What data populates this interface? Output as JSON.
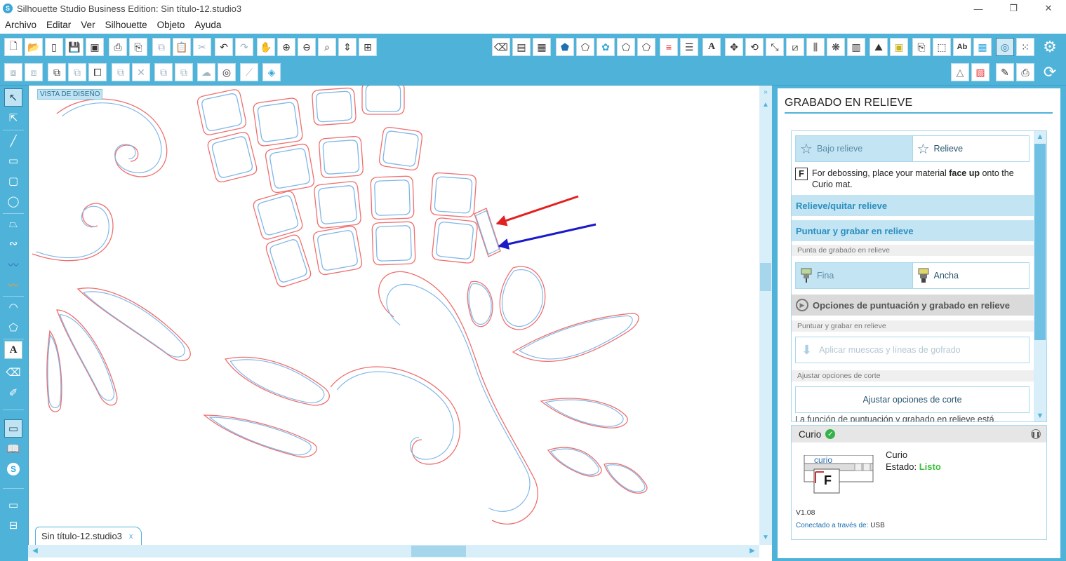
{
  "window": {
    "title": "Silhouette Studio Business Edition: Sin título-12.studio3",
    "controls": [
      "—",
      "❐",
      "✕"
    ]
  },
  "menu": [
    "Archivo",
    "Editar",
    "Ver",
    "Silhouette",
    "Objeto",
    "Ayuda"
  ],
  "canvas": {
    "view_label": "VISTA DE DISEÑO",
    "doc_tab": "Sin título-12.studio3",
    "doc_tab_close": "x",
    "cut_line_color": "#ef6f6f",
    "emboss_line_color": "#7fb7e8",
    "arrow_colors": [
      "#e32020",
      "#1a1acb"
    ]
  },
  "panel": {
    "title": "GRABADO EN RELIEVE",
    "mode_buttons": [
      {
        "label": "Bajo relieve",
        "icon": "deboss-star-icon",
        "selected": true
      },
      {
        "label": "Relieve",
        "icon": "emboss-star-icon",
        "selected": false
      }
    ],
    "hint_icon": "F",
    "hint_prefix": "For debossing, place your material ",
    "hint_bold": "face up",
    "hint_suffix": " onto the Curio mat.",
    "section_toggle": "Relieve/quitar relieve",
    "section_dot": "Puntuar y grabar en relieve",
    "tip_header": "Punta de grabado en relieve",
    "tip_buttons": [
      {
        "label": "Fina",
        "icon": "fine-tip-icon",
        "selected": true
      },
      {
        "label": "Ancha",
        "icon": "broad-tip-icon",
        "selected": false
      }
    ],
    "options_band": "Opciones de puntuación y grabado en relieve",
    "dot_header": "Puntuar y grabar en relieve",
    "apply_button": "Aplicar muescas y líneas de gofrado",
    "cut_header": "Ajustar opciones de corte",
    "cut_button": "Ajustar opciones de corte",
    "cut_text": "La función de puntuación y grabado en relieve está"
  },
  "device": {
    "header": "Curio",
    "name": "Curio",
    "status_label": "Estado:",
    "status_value": "Listo",
    "version": "V1.08",
    "conn_label": "Conectado a través de:",
    "conn_value": "USB",
    "mat_label": "curio",
    "mat_letter": "F"
  }
}
